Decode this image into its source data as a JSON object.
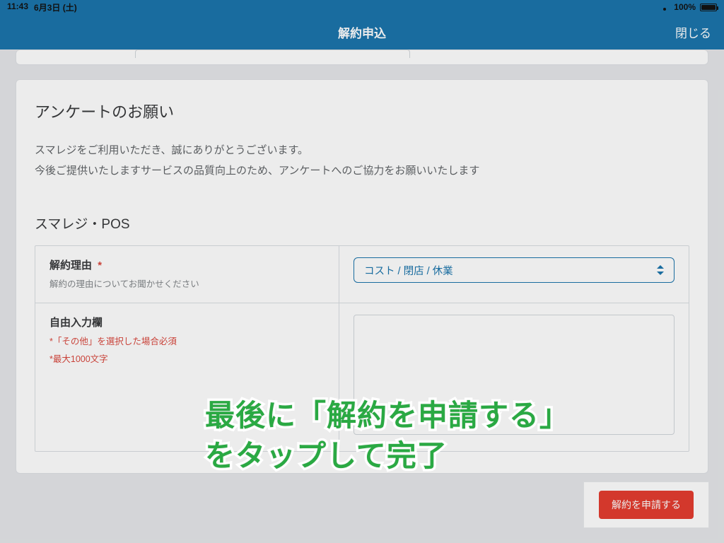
{
  "status_bar": {
    "time": "11:43",
    "date": "6月3日 (土)",
    "battery_pct": "100%"
  },
  "nav": {
    "title": "解約申込",
    "close": "閉じる"
  },
  "survey": {
    "heading": "アンケートのお願い",
    "intro_line1": "スマレジをご利用いただき、誠にありがとうございます。",
    "intro_line2": "今後ご提供いたしますサービスの品質向上のため、アンケートへのご協力をお願いいたします",
    "product_section": "スマレジ・POS",
    "reason": {
      "label": "解約理由",
      "required_mark": "*",
      "sub": "解約の理由についてお聞かせください",
      "selected": "コスト / 閉店 / 休業"
    },
    "free_text": {
      "label": "自由入力欄",
      "note1": "*「その他」を選択した場合必須",
      "note2": "*最大1000文字"
    }
  },
  "action": {
    "submit": "解約を申請する"
  },
  "overlay": {
    "line1": "最後に「解約を申請する」",
    "line2": "をタップして完了"
  }
}
